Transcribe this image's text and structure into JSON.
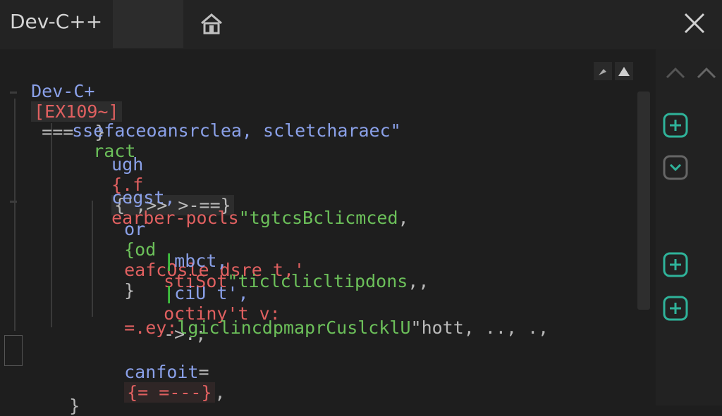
{
  "app": {
    "title": "Dev-C++"
  },
  "code": {
    "line0": {
      "a": "Dev-C+",
      "b": "[EX109~]",
      "c": " ===  }"
    },
    "line1": {
      "a": "ssefaceoansrclea, scletcharaec\"",
      "b": "  ract"
    },
    "line2": {
      "a": "ugh",
      "b": "{.f",
      "c": "{',>> >-==}"
    },
    "line3": {
      "a": "cegst,",
      "b": "earber-pocls",
      "c": "\"tgtcsBclicmced",
      "d": ","
    },
    "line4": {
      "a": "or",
      "b": "{od",
      "c": "eafcOsle dsre t,'",
      "d": "}"
    },
    "line5": {
      "a": "mbct,",
      "b": "stiSot",
      "c": "\"ticlclicltipdons",
      "d": ",,"
    },
    "line6": {
      "a": "ciU t',",
      "b": "octiny't v:",
      "c": "->.;"
    },
    "line7": {
      "a": "=.ey:",
      "b": "lgiclincdpmaprCuslcklU",
      "c": "\"hott, .., .,"
    },
    "line8": {
      "a": "canfoit",
      "b": "=",
      "c": "{= =---}",
      "d": ","
    },
    "line9": {
      "a": "}"
    }
  },
  "colors": {
    "blue": "#8aa0e8",
    "red": "#e06060",
    "green": "#6cc05a",
    "teal": "#2fb39a"
  },
  "icons": {
    "home": "home-icon",
    "close": "close-icon",
    "pin": "pin-icon",
    "triangle": "triangle-up-icon",
    "chevron_up": "chevron-up-icon",
    "add": "plus-icon",
    "collapse": "chevron-down-icon"
  }
}
